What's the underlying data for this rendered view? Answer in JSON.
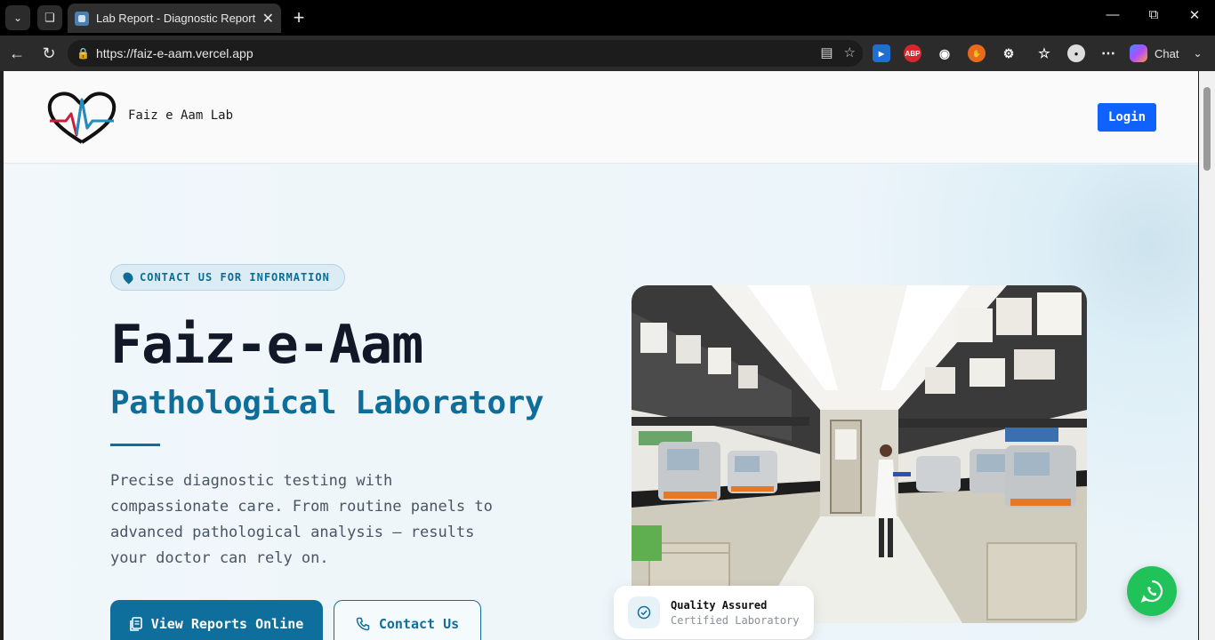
{
  "browser": {
    "tab_title": "Lab Report - Diagnostic Report Ma",
    "url": "https://faiz-e-aam.vercel.app",
    "chat_label": "Chat",
    "extensions": [
      "abp-icon",
      "camera-icon",
      "hand-icon",
      "puzzle-icon"
    ]
  },
  "site": {
    "brand": "Faiz e Aam Lab",
    "login_label": "Login"
  },
  "hero": {
    "pill_text": "CONTACT US FOR INFORMATION",
    "title": "Faiz-e-Aam",
    "subtitle": "Pathological Laboratory",
    "description": "Precise diagnostic testing with compassionate care. From routine panels to advanced pathological analysis — results your doctor can rely on.",
    "primary_button": "View Reports Online",
    "secondary_button": "Contact Us"
  },
  "badge": {
    "title": "Quality Assured",
    "subtitle": "Certified Laboratory"
  },
  "colors": {
    "accent": "#0e6f9c",
    "login": "#0f62fe",
    "whatsapp": "#22c25a"
  }
}
